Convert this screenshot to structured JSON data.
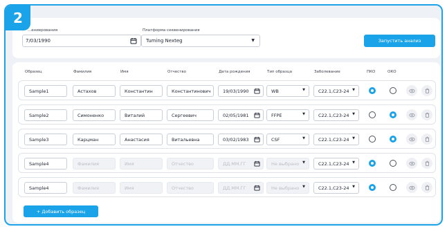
{
  "step_badge": "2",
  "top": {
    "date_label": "...ениерования",
    "date_value": "7/03/1990",
    "platform_label": "Платформа секвенирования",
    "platform_value": "Tuming Nexteg",
    "run_button": "Запустить анализ"
  },
  "table": {
    "headers": [
      "Образец",
      "Фамилия",
      "Имя",
      "Отчество",
      "Дата рождения",
      "Тип образца",
      "Заболевание",
      "ПКО",
      "ОКО"
    ],
    "rows": [
      {
        "sample": "Sample1",
        "last": "Астахов",
        "first": "Константин",
        "middle": "Константинович",
        "date": "19/03/1990",
        "type": "WB",
        "disease": "C22.1,C23-24",
        "pko": true,
        "oko": false,
        "placeholder": false
      },
      {
        "sample": "Sample2",
        "last": "Симоненко",
        "first": "Виталий",
        "middle": "Сергеевич",
        "date": "02/05/1981",
        "type": "FFPE",
        "disease": "C22.1,C23-24",
        "pko": false,
        "oko": true,
        "placeholder": false
      },
      {
        "sample": "Sample3",
        "last": "Карцман",
        "first": "Анастасия",
        "middle": "Витальевна",
        "date": "03/02/1983",
        "type": "CSF",
        "disease": "C22.1,C23-24",
        "pko": false,
        "oko": true,
        "placeholder": false
      },
      {
        "sample": "Sample4",
        "last": "Фамилия",
        "first": "Имя",
        "middle": "Отчество",
        "date": "ДД.ММ.ГГ",
        "type": "Не выбрано",
        "disease": "C22.1,C23-24",
        "pko": true,
        "oko": false,
        "placeholder": true
      },
      {
        "sample": "Sample4",
        "last": "Фамилия",
        "first": "Имя",
        "middle": "Отчество",
        "date": "ДД.ММ.ГГ",
        "type": "Не выбрано",
        "disease": "C22.1,C23-24",
        "pko": true,
        "oko": false,
        "placeholder": true
      }
    ],
    "add_button": "+   Добавить образец"
  },
  "colors": {
    "accent": "#1aa3e8",
    "frame_bg": "#eef1f5"
  },
  "icons": [
    "calendar-icon",
    "caret-down-icon",
    "eye-icon",
    "trash-icon"
  ]
}
